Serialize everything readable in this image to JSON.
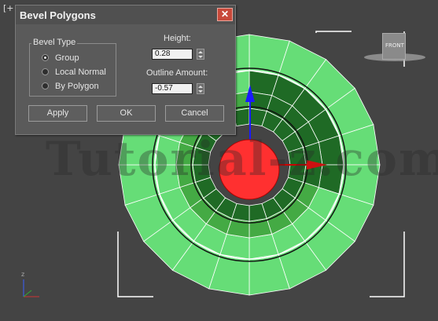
{
  "viewport": {
    "label": "[+",
    "viewcube_label": "FRONT",
    "watermark": "Tutorial-z.com",
    "axis_labels": {
      "z": "z"
    }
  },
  "dialog": {
    "title": "Bevel Polygons",
    "close_icon": "close-icon",
    "bevel_type": {
      "legend": "Bevel Type",
      "options": [
        "Group",
        "Local Normal",
        "By Polygon"
      ],
      "selected": "Group"
    },
    "height": {
      "label": "Height:",
      "value": "0.28"
    },
    "outline": {
      "label": "Outline Amount:",
      "value": "-0.57"
    },
    "buttons": {
      "apply": "Apply",
      "ok": "OK",
      "cancel": "Cancel"
    }
  },
  "colors": {
    "viewport_bg": "#444444",
    "mesh_light": "#66dd77",
    "mesh_dark": "#1f6a25",
    "mesh_mid": "#44aa44",
    "center_sphere": "#ff3333",
    "gizmo_y": "#0000cc",
    "gizmo_x": "#cc0000",
    "close_button": "#c8493a"
  }
}
